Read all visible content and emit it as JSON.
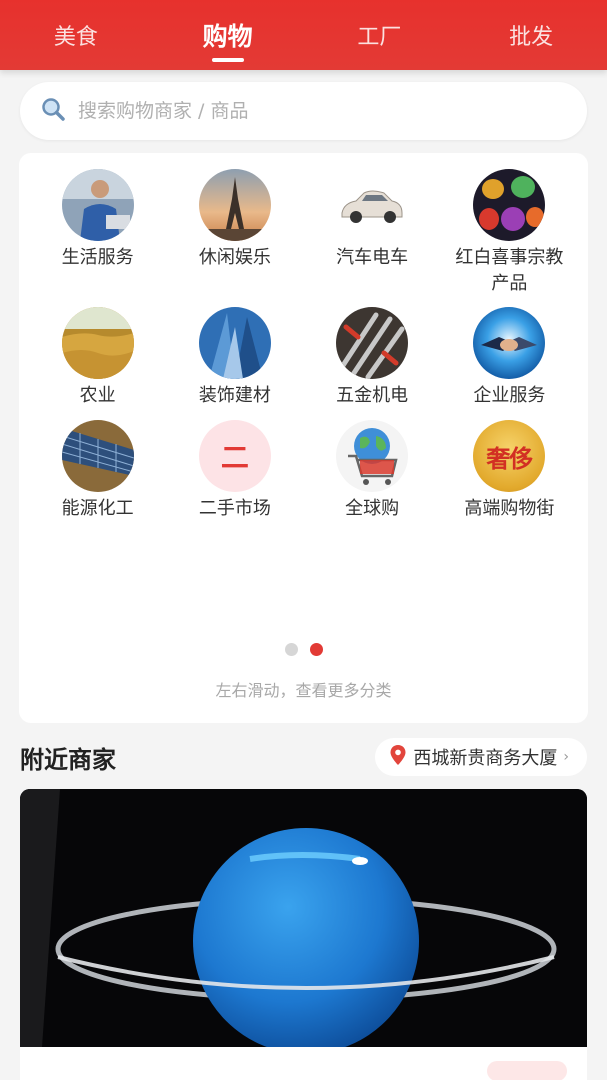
{
  "header": {
    "tabs": [
      {
        "label": "美食",
        "active": false
      },
      {
        "label": "购物",
        "active": true
      },
      {
        "label": "工厂",
        "active": false
      },
      {
        "label": "批发",
        "active": false
      }
    ],
    "accent_color": "#e5322e"
  },
  "search": {
    "placeholder": "搜索购物商家 / 商品",
    "icon": "search-icon"
  },
  "categories": {
    "rows": [
      [
        {
          "label": "生活服务",
          "icon": "worker-photo"
        },
        {
          "label": "休闲娱乐",
          "icon": "eiffel-tower-photo"
        },
        {
          "label": "汽车电车",
          "icon": "car-photo"
        },
        {
          "label": "红白喜事宗教产品",
          "icon": "lanterns-photo"
        }
      ],
      [
        {
          "label": "农业",
          "icon": "wheat-photo"
        },
        {
          "label": "装饰建材",
          "icon": "skyscraper-photo"
        },
        {
          "label": "五金机电",
          "icon": "wrenches-photo"
        },
        {
          "label": "企业服务",
          "icon": "handshake-photo"
        }
      ],
      [
        {
          "label": "能源化工",
          "icon": "solar-panel-photo"
        },
        {
          "label": "二手市场",
          "icon": "secondhand-badge",
          "badge_text": "二"
        },
        {
          "label": "全球购",
          "icon": "globe-cart-photo"
        },
        {
          "label": "高端购物街",
          "icon": "luxury-badge",
          "badge_text": "奢侈"
        }
      ]
    ],
    "page_indicator": {
      "total": 2,
      "current": 2
    },
    "hint": "左右滑动，查看更多分类"
  },
  "nearby": {
    "title": "附近商家",
    "location": "西城新贵商务大厦",
    "location_icon": "map-pin-icon"
  }
}
